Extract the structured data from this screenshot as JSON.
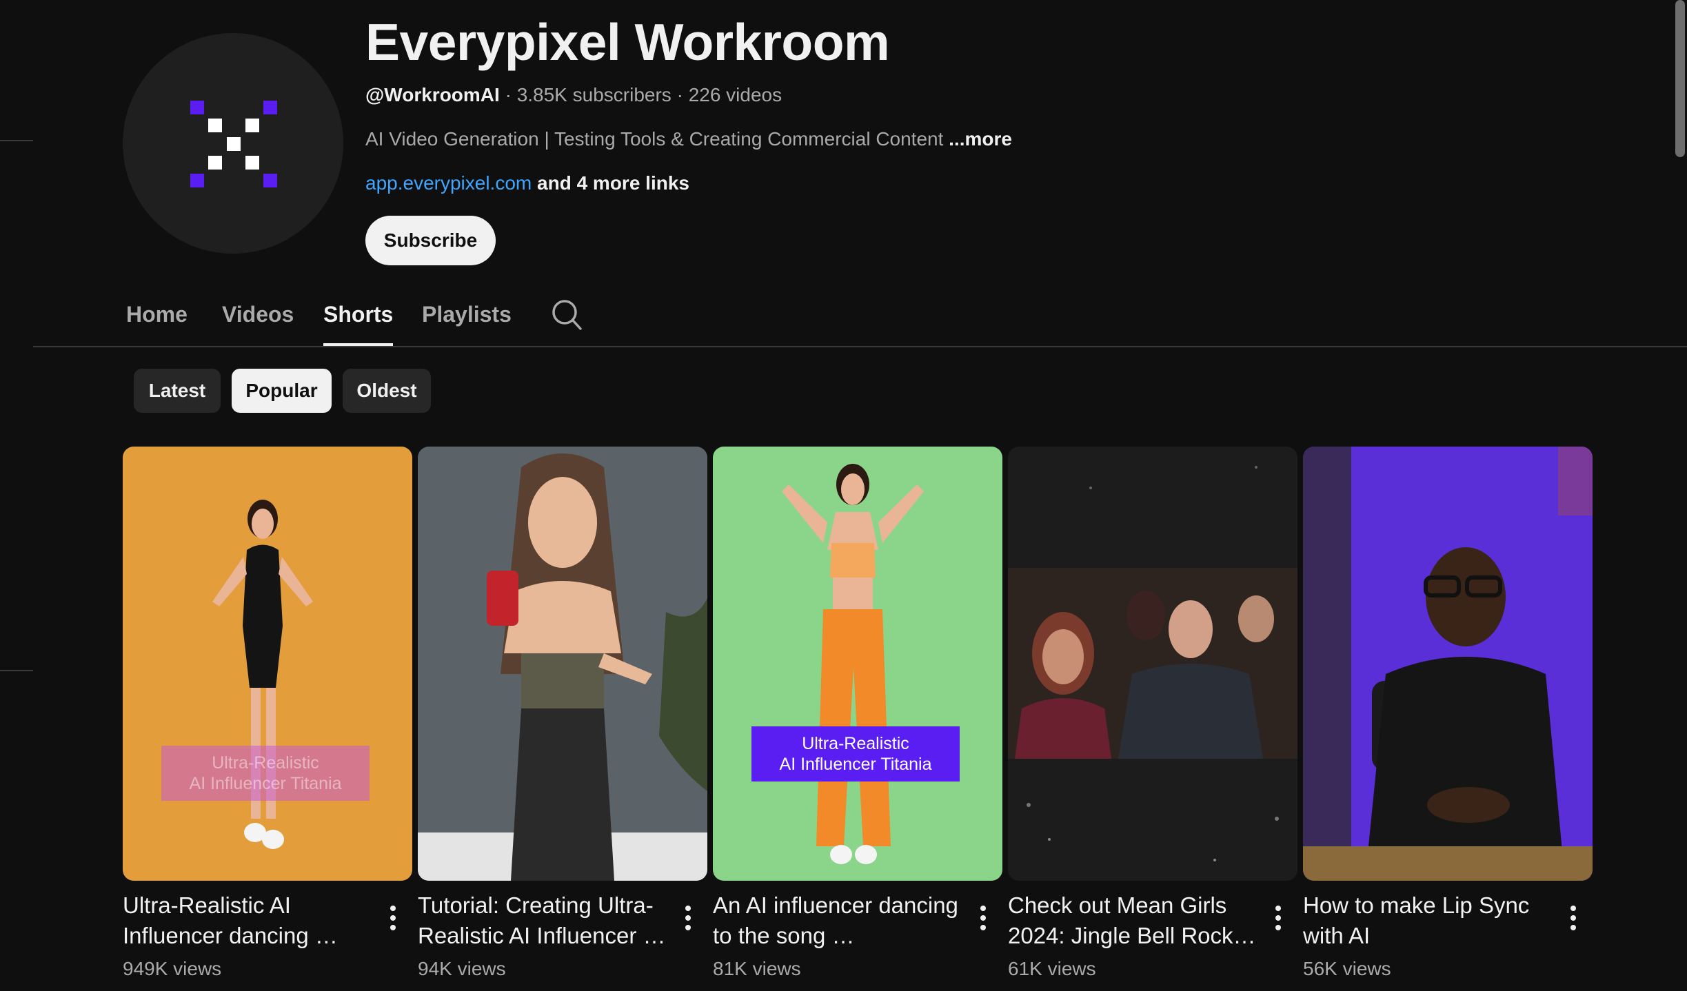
{
  "channel": {
    "title": "Everypixel Workroom",
    "handle": "@WorkroomAI",
    "subscribers": "3.85K subscribers",
    "videos_count": "226 videos",
    "separator": "·",
    "description": "AI Video Generation | Testing Tools & Creating Commercial Content",
    "description_more": "...more",
    "link": "app.everypixel.com",
    "more_links": "and 4 more links",
    "subscribe_label": "Subscribe"
  },
  "tabs": [
    {
      "label": "Home",
      "active": false
    },
    {
      "label": "Videos",
      "active": false
    },
    {
      "label": "Shorts",
      "active": true
    },
    {
      "label": "Playlists",
      "active": false
    }
  ],
  "filters": [
    {
      "label": "Latest",
      "selected": false
    },
    {
      "label": "Popular",
      "selected": true
    },
    {
      "label": "Oldest",
      "selected": false
    }
  ],
  "shorts": [
    {
      "title": "Ultra-Realistic AI Influencer dancing …",
      "views": "949K views",
      "overlay": [
        "Ultra-Realistic",
        "AI Influencer Titania"
      ]
    },
    {
      "title": "Tutorial: Creating Ultra-Realistic AI Influencer …",
      "views": "94K views"
    },
    {
      "title": "An AI influencer dancing to the song …",
      "views": "81K views",
      "overlay": [
        "Ultra-Realistic",
        "AI Influencer Titania"
      ]
    },
    {
      "title": "Check out Mean Girls 2024: Jingle Bell Rock…",
      "views": "61K views"
    },
    {
      "title": "How to make Lip Sync with AI",
      "views": "56K views"
    }
  ],
  "colors": {
    "background": "#0f0f0f",
    "link": "#3ea6ff",
    "brand_purple": "#5b1ef2"
  },
  "icons": {
    "search": "search-icon",
    "more": "more-vert-icon",
    "logo": "everypixel-logo"
  }
}
